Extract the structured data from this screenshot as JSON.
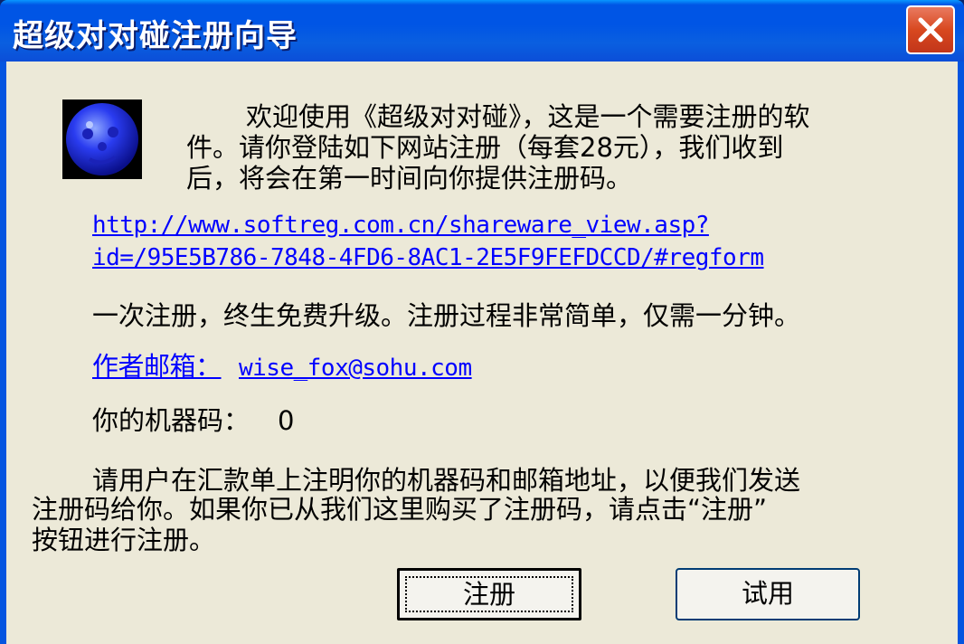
{
  "window": {
    "title": "超级对对碰注册向导"
  },
  "icons": {
    "close": "close-icon",
    "app": "smiley-face-icon"
  },
  "colors": {
    "titlebar": "#0055e5",
    "client_bg": "#ece9d8",
    "link": "#0000ff",
    "close_button": "#d8481f"
  },
  "intro": {
    "line1": "欢迎使用《超级对对碰》，这是一个需要注册的软",
    "line2": "件。请你登陆如下网站注册（每套28元），我们收到",
    "line3": "后，将会在第一时间向你提供注册码。"
  },
  "register_link": {
    "line1": "http://www.softreg.com.cn/shareware_view.asp?",
    "line2": "id=/95E5B786-7848-4FD6-8AC1-2E5F9FEFDCCD/#regform"
  },
  "upgrade_note": "一次注册，终生免费升级。注册过程非常简单，仅需一分钟。",
  "author_email": {
    "label": "作者邮箱：",
    "address": "wise_fox@sohu.com"
  },
  "machine_code": {
    "label": "你的机器码：",
    "value": "0"
  },
  "instructions": {
    "line1": "请用户在汇款单上注明你的机器码和邮箱地址，以便我们发送",
    "line2": "注册码给你。如果你已从我们这里购买了注册码，请点击“注册”",
    "line3": "按钮进行注册。"
  },
  "buttons": {
    "register": "注册",
    "trial": "试用"
  }
}
